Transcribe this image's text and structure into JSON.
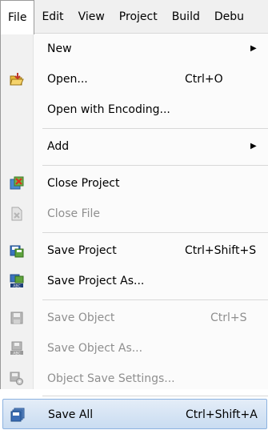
{
  "menubar": {
    "items": [
      "File",
      "Edit",
      "View",
      "Project",
      "Build",
      "Debu"
    ]
  },
  "menu": {
    "items": [
      {
        "label": "New",
        "shortcut": "",
        "submenu": true
      },
      {
        "label": "Open...",
        "shortcut": "Ctrl+O"
      },
      {
        "label": "Open with Encoding...",
        "shortcut": ""
      },
      {
        "label": "Add",
        "shortcut": "",
        "submenu": true
      },
      {
        "label": "Close Project",
        "shortcut": ""
      },
      {
        "label": "Close File",
        "shortcut": "",
        "disabled": true
      },
      {
        "label": "Save Project",
        "shortcut": "Ctrl+Shift+S"
      },
      {
        "label": "Save Project As...",
        "shortcut": ""
      },
      {
        "label": "Save Object",
        "shortcut": "Ctrl+S",
        "disabled": true
      },
      {
        "label": "Save Object As...",
        "shortcut": "",
        "disabled": true
      },
      {
        "label": "Object Save Settings...",
        "shortcut": "",
        "disabled": true
      },
      {
        "label": "Save All",
        "shortcut": "Ctrl+Shift+A",
        "highlighted": true
      }
    ],
    "submenu_arrow": "▶",
    "icons": [
      "open-folder-icon",
      "close-project-icon",
      "close-file-icon",
      "save-project-icon",
      "save-project-as-icon",
      "save-object-icon",
      "save-object-as-icon",
      "object-save-settings-icon",
      "save-all-icon"
    ],
    "colors": {
      "highlight": "#c9dcf1",
      "highlight_border": "#8cb2e0",
      "disabled_text": "#8f8f8f"
    }
  }
}
